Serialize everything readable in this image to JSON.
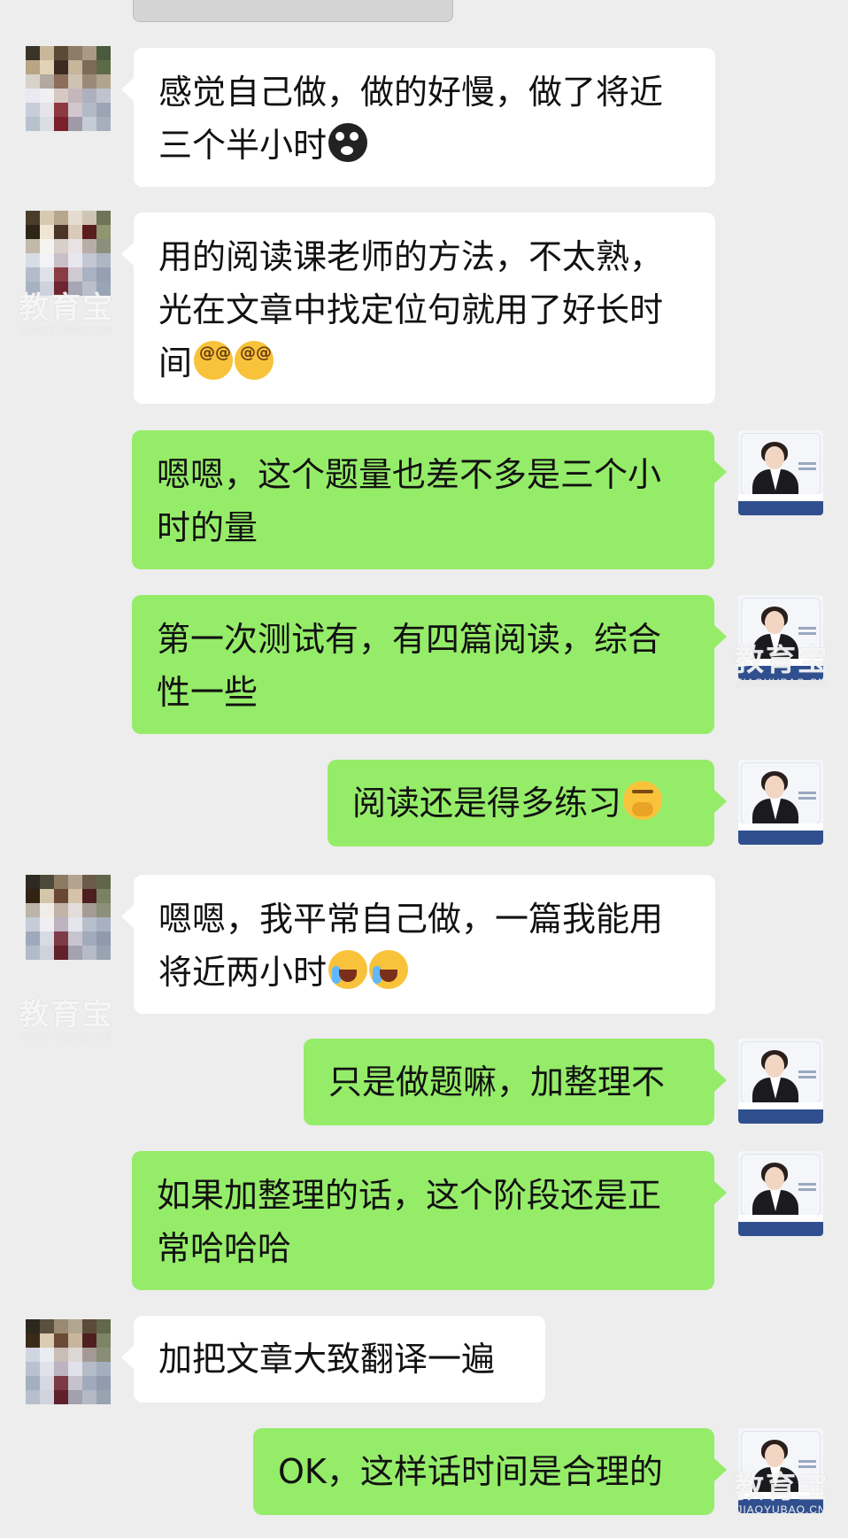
{
  "messages": [
    {
      "side": "left",
      "text": "感觉自己做，做的好慢，做了将近三个半小时",
      "emojis": [
        "shocked-crying-emoji"
      ]
    },
    {
      "side": "left",
      "text": "用的阅读课老师的方法，不太熟，光在文章中找定位句就用了好长时间",
      "emojis": [
        "dizzy-face-emoji",
        "dizzy-face-emoji"
      ]
    },
    {
      "side": "right",
      "text": "嗯嗯，这个题量也差不多是三个小时的量",
      "emojis": []
    },
    {
      "side": "right",
      "text": "第一次测试有，有四篇阅读，综合性一些",
      "emojis": []
    },
    {
      "side": "right",
      "text": "阅读还是得多练习",
      "emojis": [
        "hand-over-mouth-emoji"
      ]
    },
    {
      "side": "left",
      "text": "嗯嗯，我平常自己做，一篇我能用将近两小时",
      "emojis": [
        "crying-face-emoji",
        "crying-face-emoji"
      ]
    },
    {
      "side": "right",
      "text": "只是做题嘛，加整理不",
      "emojis": []
    },
    {
      "side": "right",
      "text": "如果加整理的话，这个阶段还是正常哈哈哈",
      "emojis": []
    },
    {
      "side": "left",
      "text": "加把文章大致翻译一遍",
      "emojis": []
    },
    {
      "side": "right",
      "text": "OK，这样话时间是合理的",
      "emojis": []
    }
  ],
  "watermark": {
    "brand": "教育宝",
    "domain": "JIAOYUBAO.CN"
  },
  "colors": {
    "background": "#ededed",
    "left_bubble": "#ffffff",
    "right_bubble": "#95ec69"
  }
}
